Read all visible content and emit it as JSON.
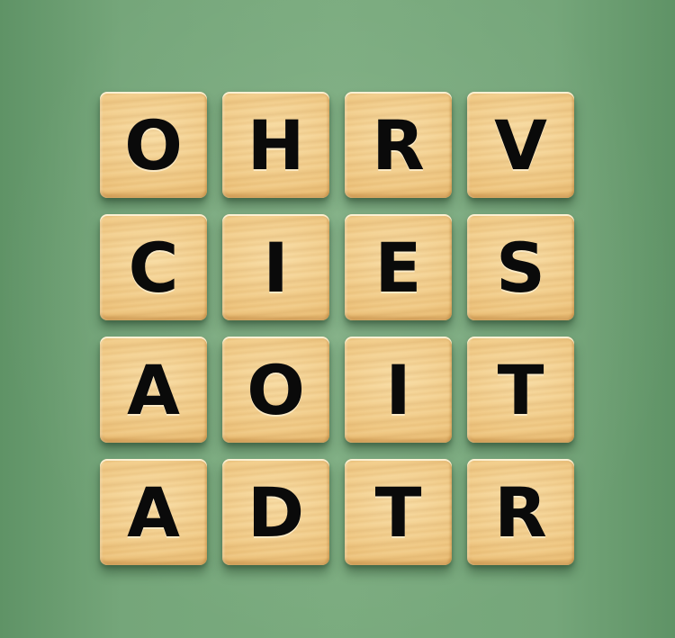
{
  "board": {
    "rows": [
      [
        "O",
        "H",
        "R",
        "V"
      ],
      [
        "C",
        "I",
        "E",
        "S"
      ],
      [
        "A",
        "O",
        "I",
        "T"
      ],
      [
        "A",
        "D",
        "T",
        "R"
      ]
    ]
  },
  "colors": {
    "background": "#78a97c",
    "tile": "#f0c985",
    "letter": "#0a0a0a"
  }
}
